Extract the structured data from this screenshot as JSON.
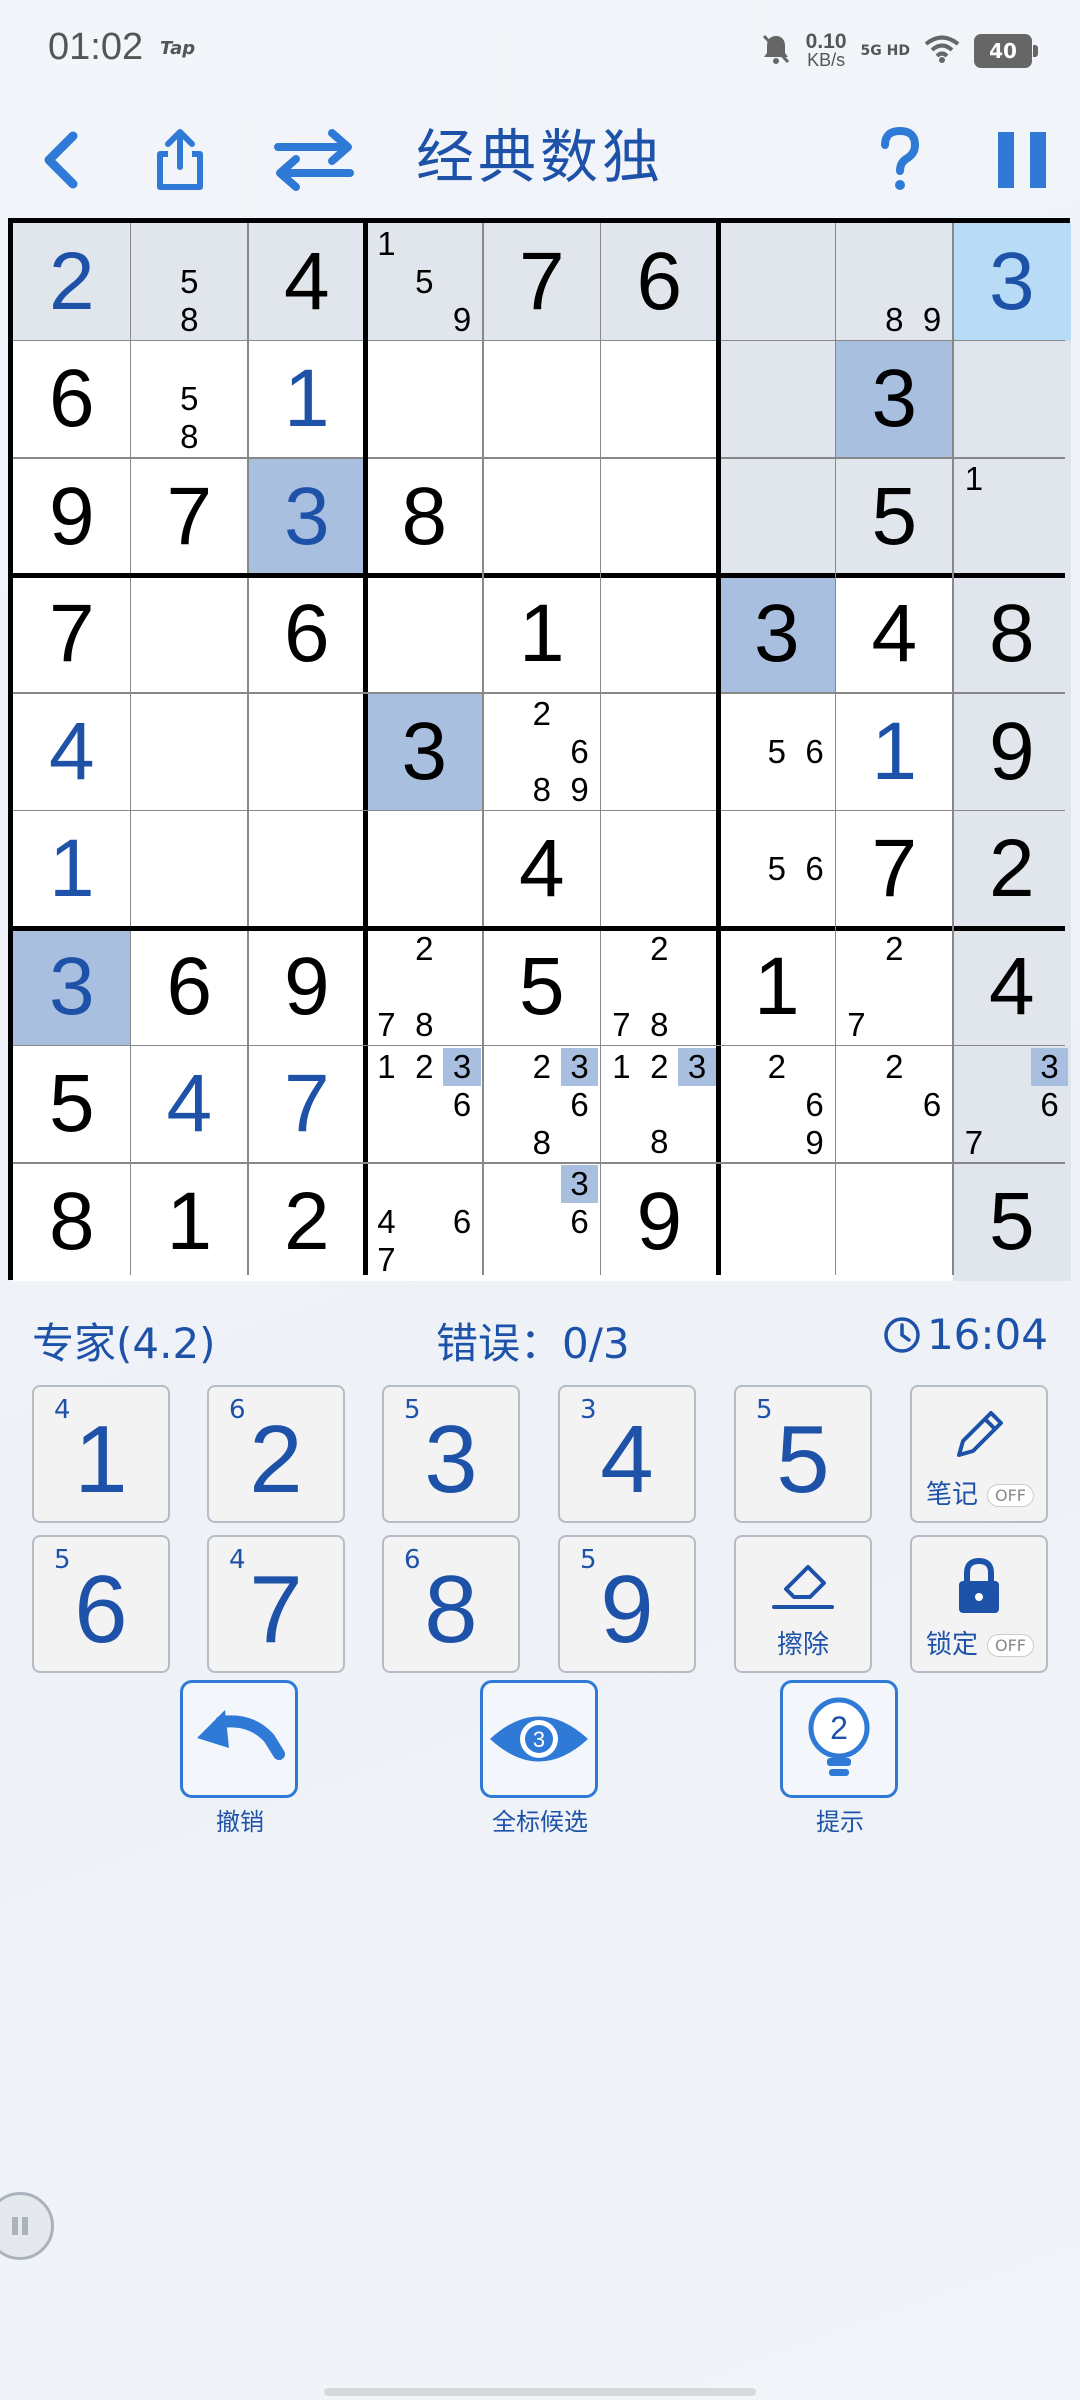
{
  "status_bar": {
    "time": "01:02",
    "app_hint": "Tap",
    "net_speed_value": "0.10",
    "net_speed_unit": "KB/s",
    "network": "5G HD",
    "battery": "40"
  },
  "header": {
    "title": "经典数独"
  },
  "board": {
    "rows": [
      [
        {
          "v": "2",
          "t": "user"
        },
        {
          "n": [
            "5",
            "8"
          ]
        },
        {
          "v": "4",
          "t": "given"
        },
        {
          "n": [
            "1",
            "5",
            "9"
          ]
        },
        {
          "v": "7",
          "t": "given"
        },
        {
          "v": "6",
          "t": "given"
        },
        {
          "n": []
        },
        {
          "n": [
            "8",
            "9"
          ]
        },
        {
          "v": "3",
          "t": "user"
        }
      ],
      [
        {
          "v": "6",
          "t": "given"
        },
        {
          "n": [
            "5",
            "8"
          ]
        },
        {
          "v": "1",
          "t": "user"
        },
        {
          "n": []
        },
        {
          "n": []
        },
        {
          "n": []
        },
        {
          "n": []
        },
        {
          "v": "3",
          "t": "given"
        },
        {
          "n": []
        }
      ],
      [
        {
          "v": "9",
          "t": "given"
        },
        {
          "v": "7",
          "t": "given"
        },
        {
          "v": "3",
          "t": "user"
        },
        {
          "v": "8",
          "t": "given"
        },
        {
          "n": []
        },
        {
          "n": []
        },
        {
          "n": []
        },
        {
          "v": "5",
          "t": "given"
        },
        {
          "n": [
            "1"
          ]
        }
      ],
      [
        {
          "v": "7",
          "t": "given"
        },
        {
          "n": []
        },
        {
          "v": "6",
          "t": "given"
        },
        {
          "n": []
        },
        {
          "v": "1",
          "t": "given"
        },
        {
          "n": []
        },
        {
          "v": "3",
          "t": "given"
        },
        {
          "v": "4",
          "t": "given"
        },
        {
          "v": "8",
          "t": "given"
        }
      ],
      [
        {
          "v": "4",
          "t": "user"
        },
        {
          "n": []
        },
        {
          "n": []
        },
        {
          "v": "3",
          "t": "given"
        },
        {
          "n": [
            "2",
            "6",
            "8",
            "9"
          ]
        },
        {
          "n": []
        },
        {
          "n": [
            "5",
            "6"
          ]
        },
        {
          "v": "1",
          "t": "user"
        },
        {
          "v": "9",
          "t": "given"
        }
      ],
      [
        {
          "v": "1",
          "t": "user"
        },
        {
          "n": []
        },
        {
          "n": []
        },
        {
          "n": []
        },
        {
          "v": "4",
          "t": "given"
        },
        {
          "n": []
        },
        {
          "n": [
            "5",
            "6"
          ]
        },
        {
          "v": "7",
          "t": "given"
        },
        {
          "v": "2",
          "t": "given"
        }
      ],
      [
        {
          "v": "3",
          "t": "user"
        },
        {
          "v": "6",
          "t": "given"
        },
        {
          "v": "9",
          "t": "given"
        },
        {
          "n": [
            "2",
            "7",
            "8"
          ]
        },
        {
          "v": "5",
          "t": "given"
        },
        {
          "n": [
            "2",
            "7",
            "8"
          ]
        },
        {
          "v": "1",
          "t": "given"
        },
        {
          "n": [
            "2",
            "7"
          ]
        },
        {
          "v": "4",
          "t": "given"
        }
      ],
      [
        {
          "v": "5",
          "t": "given"
        },
        {
          "v": "4",
          "t": "user"
        },
        {
          "v": "7",
          "t": "user"
        },
        {
          "n": [
            "1",
            "2",
            "3",
            "6"
          ]
        },
        {
          "n": [
            "2",
            "3",
            "6",
            "8"
          ]
        },
        {
          "n": [
            "1",
            "2",
            "3",
            "8"
          ]
        },
        {
          "n": [
            "2",
            "6",
            "9"
          ]
        },
        {
          "n": [
            "2",
            "6"
          ]
        },
        {
          "n": [
            "3",
            "6",
            "7"
          ]
        }
      ],
      [
        {
          "v": "8",
          "t": "given"
        },
        {
          "v": "1",
          "t": "given"
        },
        {
          "v": "2",
          "t": "given"
        },
        {
          "n": [
            "4",
            "6",
            "7"
          ]
        },
        {
          "n": [
            "3",
            "6"
          ]
        },
        {
          "v": "9",
          "t": "given"
        },
        {
          "n": []
        },
        {
          "n": []
        },
        {
          "v": "5",
          "t": "given"
        }
      ]
    ],
    "selected_cell": "r1c9",
    "highlight_color": "#a9bfe0",
    "selected_color": "#b9dcf6",
    "peer_color": "#e1e5ec"
  },
  "info": {
    "difficulty": "专家(4.2)",
    "mistakes": "错误：0/3",
    "timer": "16:04"
  },
  "keypad": {
    "numbers": [
      {
        "digit": "1",
        "remaining": "4"
      },
      {
        "digit": "2",
        "remaining": "6"
      },
      {
        "digit": "3",
        "remaining": "5"
      },
      {
        "digit": "4",
        "remaining": "3"
      },
      {
        "digit": "5",
        "remaining": "5"
      },
      {
        "digit": "6",
        "remaining": "5"
      },
      {
        "digit": "7",
        "remaining": "4"
      },
      {
        "digit": "8",
        "remaining": "6"
      },
      {
        "digit": "9",
        "remaining": "5"
      }
    ],
    "notes_label": "笔记",
    "notes_state": "OFF",
    "erase_label": "擦除",
    "lock_label": "锁定",
    "lock_state": "OFF"
  },
  "actions": {
    "undo_label": "撤销",
    "candidates_label": "全标候选",
    "candidates_badge": "3",
    "hint_label": "提示",
    "hint_badge": "2"
  },
  "colors": {
    "accent": "#1d52a8",
    "button_border": "#2f7ad6"
  }
}
